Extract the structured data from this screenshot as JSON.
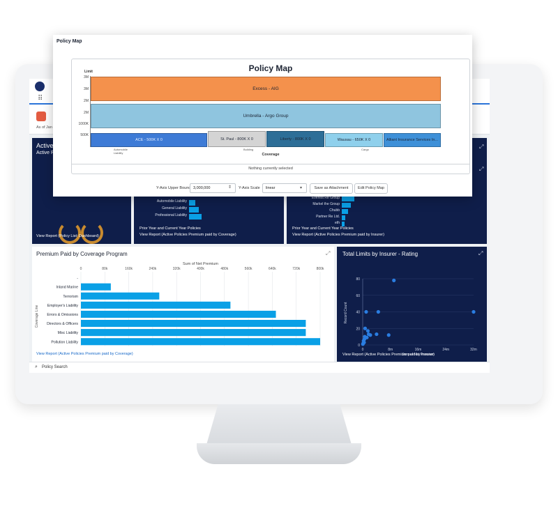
{
  "popup": {
    "header": "Policy Map",
    "chart_title": "Policy Map",
    "limit_label": "Limit",
    "coverage_label": "Coverage",
    "status": "Nothing currently selected",
    "y_axis_upper_bound_label": "Y-Axis Upper Bound",
    "y_axis_upper_bound_value": "3,000,000",
    "y_axis_scale_label": "Y-Axis Scale",
    "y_axis_scale_value": "linear",
    "save_attachment_label": "Save as Attachment",
    "edit_policy_map_label": "Edit Policy Map"
  },
  "chart_data": [
    {
      "type": "bar",
      "title": "Policy Map",
      "ylabel": "Limit",
      "xlabel": "Coverage",
      "y_ticks": [
        "3M",
        "3M",
        "2M",
        "2M",
        "1000K",
        "500K"
      ],
      "x_ticks": [
        "Automobile Liability",
        "Building",
        "Cargo"
      ],
      "blocks": [
        {
          "label": "Excess - AIG",
          "color": "#f4914c"
        },
        {
          "label": "Umbrella - Argo Group",
          "color": "#8fc5df"
        },
        {
          "label": "ACE - 500K X 0",
          "color": "#3e7bd6"
        },
        {
          "label": "St. Paul - 800K X 0",
          "color": "#d4d4d4"
        },
        {
          "label": "Liberty - 800K X 0",
          "color": "#2d6e97"
        },
        {
          "label": "Wausau - 650K X 0",
          "color": "#8fd0ec"
        },
        {
          "label": "Alliant Insurance Services In...",
          "color": "#3e90d8"
        }
      ]
    },
    {
      "type": "bar",
      "title": "Premium Paid by Coverage Program",
      "xlabel": "Sum of Net Premium",
      "ylabel": "Coverage Line",
      "x_ticks": [
        "0",
        "80k",
        "160k",
        "240k",
        "320k",
        "400k",
        "480k",
        "560k",
        "640k",
        "720k",
        "800k"
      ],
      "xlim": [
        0,
        800000
      ],
      "categories": [
        "-",
        "Inland Marine",
        "Terrorism",
        "Employer's Liability",
        "Errors & Omissions",
        "Directors & Officers",
        "Misc Liability",
        "Pollution Liability"
      ],
      "values": [
        0,
        100000,
        262000,
        500000,
        652000,
        752000,
        752000,
        800000
      ],
      "color": "#0aa0e6"
    },
    {
      "type": "scatter",
      "title": "Total Limits by Insurer - Rating",
      "xlabel": "Sum of Net Premium",
      "ylabel": "Record Count",
      "x_ticks": [
        "0",
        "8m",
        "16m",
        "24m",
        "32m"
      ],
      "y_ticks": [
        "0",
        "20",
        "40",
        "60",
        "80"
      ],
      "xlim": [
        0,
        32000000
      ],
      "ylim": [
        0,
        80
      ],
      "x": [
        9000000,
        32000000,
        1000000,
        4500000,
        700000,
        1500000,
        4000000,
        7500000,
        1700000,
        600000,
        1200000,
        500000,
        250000,
        400000,
        150000,
        50000,
        2200000
      ],
      "y": [
        78,
        40,
        40,
        40,
        20,
        17,
        13,
        12,
        13,
        10,
        9,
        7,
        5,
        3,
        2,
        1,
        12
      ],
      "color": "#2a7de1"
    },
    {
      "type": "bar",
      "title": "",
      "categories": [
        "Automobile Liability",
        "General Liability",
        "Professional Liability"
      ],
      "values": [
        9,
        14,
        18
      ],
      "color": "#0aa0e6"
    },
    {
      "type": "bar",
      "title": "",
      "categories": [
        "Everest Re Group",
        "Markel the Group",
        "Chubb",
        "Partner Re Ltd.",
        "eth"
      ],
      "values": [
        14,
        10,
        7,
        4,
        3
      ],
      "color": "#0aa0e6"
    }
  ],
  "dashboard": {
    "as_of": "As of Jan 2",
    "panel1_title": "Active P",
    "panel1_subtitle": "Active P",
    "panel1_link": "View Report (Policy List: Dashboard)",
    "panel2_caption": "Prior Year and Current Year Policies",
    "panel2_link": "View Report (Active Policies Premium paid by Coverage)",
    "panel3_caption": "Prior Year and Current Year Policies",
    "panel3_link": "View Report (Active Policies Premium paid by Insurer)",
    "premium_link": "View Report (Active Policies Premium paid by Coverage)",
    "scatter_link": "View Report (Active Policies Premium paid by Insurer)",
    "policy_search": "Policy Search"
  }
}
